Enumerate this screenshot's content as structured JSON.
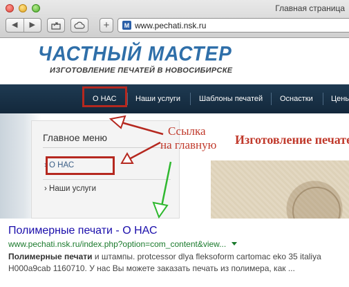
{
  "browser": {
    "window_title": "Главная страница",
    "url": "www.pechati.nsk.ru",
    "favicon_letter": "M",
    "back_glyph": "◀",
    "forward_glyph": "▶",
    "new_tab_glyph": "+"
  },
  "site": {
    "logo_title": "ЧАСТНЫЙ МАСТЕР",
    "logo_subtitle": "ИЗГОТОВЛЕНИЕ ПЕЧАТЕЙ В НОВОСИБИРСКЕ",
    "menu": [
      {
        "label": "О НАС"
      },
      {
        "label": "Наши услуги"
      },
      {
        "label": "Шаблоны печатей"
      },
      {
        "label": "Оснастки"
      },
      {
        "label": "Цены"
      }
    ],
    "sidebar": {
      "title": "Главное меню",
      "items": [
        {
          "label": "› О НАС"
        },
        {
          "label": "› Наши услуги"
        }
      ]
    },
    "heading": "Изготовление печатей"
  },
  "annotation": {
    "line1": "Ссылка",
    "line2": "на главную",
    "color_red": "#b5281f",
    "color_green": "#2fb82f"
  },
  "search_result": {
    "title": "Полимерные печати - О НАС",
    "url": "www.pechati.nsk.ru/index.php?option=com_content&view...",
    "snippet_bold": "Полимерные печати",
    "snippet_rest": " и штампы. protcessor dlya fleksoform cartomac eko 35 italiya H000a9cab 1160710. У нас Вы можете заказать печать из полимера, как ..."
  }
}
